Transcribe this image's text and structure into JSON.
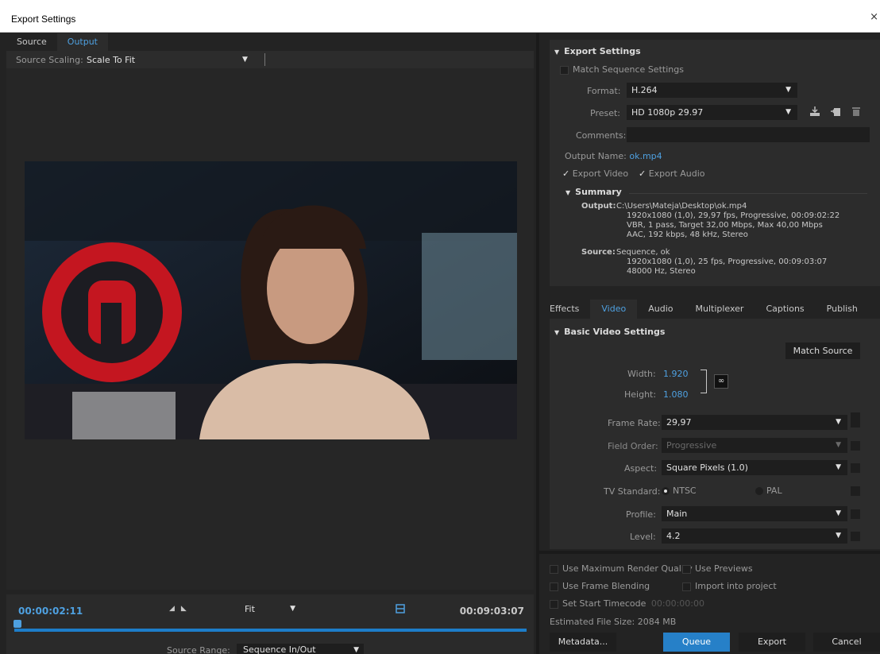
{
  "window": {
    "title": "Export Settings",
    "close": "×"
  },
  "left": {
    "tabs": [
      "Source",
      "Output"
    ],
    "active_tab": "Output",
    "source_scaling_label": "Source Scaling:",
    "source_scaling_value": "Scale To Fit",
    "timeline": {
      "current": "00:00:02:11",
      "duration": "00:09:03:07",
      "zoom": "Fit",
      "source_range_label": "Source Range:",
      "source_range_value": "Sequence In/Out",
      "playhead_fraction": 0.004
    }
  },
  "export_settings": {
    "header": "Export Settings",
    "match_sequence": "Match Sequence Settings",
    "format_label": "Format:",
    "format_value": "H.264",
    "preset_label": "Preset:",
    "preset_value": "HD 1080p 29.97",
    "comments_label": "Comments:",
    "output_name_label": "Output Name:",
    "output_name_value": "ok.mp4",
    "export_video": "Export Video",
    "export_audio": "Export Audio",
    "summary": {
      "header": "Summary",
      "output_label": "Output:",
      "output_lines": [
        "C:\\Users\\Mateja\\Desktop\\ok.mp4",
        "1920x1080 (1,0), 29,97 fps, Progressive, 00:09:02:22",
        "VBR, 1 pass, Target 32,00 Mbps, Max 40,00 Mbps",
        "AAC, 192 kbps, 48 kHz, Stereo"
      ],
      "source_label": "Source:",
      "source_lines": [
        "Sequence, ok",
        "1920x1080 (1,0), 25 fps, Progressive, 00:09:03:07",
        "48000 Hz, Stereo"
      ]
    }
  },
  "settings_tabs": [
    "Effects",
    "Video",
    "Audio",
    "Multiplexer",
    "Captions",
    "Publish"
  ],
  "active_settings_tab": "Video",
  "basic_video": {
    "header": "Basic Video Settings",
    "match_source": "Match Source",
    "width_label": "Width:",
    "width_value": "1.920",
    "height_label": "Height:",
    "height_value": "1.080",
    "frame_rate_label": "Frame Rate:",
    "frame_rate_value": "29,97",
    "field_order_label": "Field Order:",
    "field_order_value": "Progressive",
    "aspect_label": "Aspect:",
    "aspect_value": "Square Pixels (1.0)",
    "tv_standard_label": "TV Standard:",
    "ntsc": "NTSC",
    "pal": "PAL",
    "profile_label": "Profile:",
    "profile_value": "Main",
    "level_label": "Level:",
    "level_value": "4.2"
  },
  "bottom": {
    "max_render": "Use Maximum Render Quality",
    "use_previews": "Use Previews",
    "frame_blending": "Use Frame Blending",
    "import_project": "Import into project",
    "start_timecode": "Set Start Timecode",
    "start_timecode_value": "00:00:00:00",
    "file_size_label": "Estimated File Size:",
    "file_size_value": "2084 MB",
    "metadata": "Metadata...",
    "queue": "Queue",
    "export": "Export",
    "cancel": "Cancel"
  }
}
